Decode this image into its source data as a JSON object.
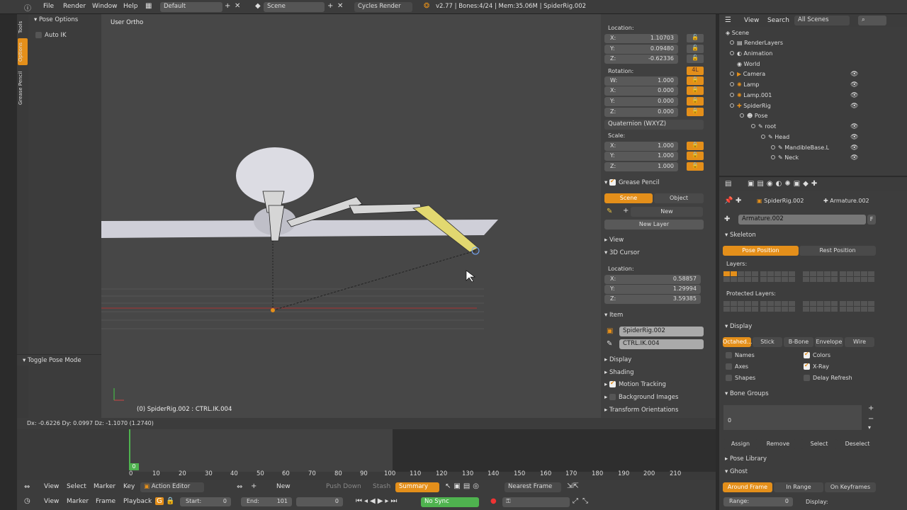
{
  "topbar": {
    "menus": [
      "File",
      "Render",
      "Window",
      "Help"
    ],
    "layout": "Default",
    "scene": "Scene",
    "engine": "Cycles Render",
    "info": "v2.77 | Bones:4/24 | Mem:35.06M | SpiderRig.002"
  },
  "shelf": {
    "tabs": [
      "Tools",
      "Options",
      "Grease Pencil"
    ],
    "pose_options": "Pose Options",
    "auto_ik": "Auto IK",
    "toggle_pose": "Toggle Pose Mode"
  },
  "viewport": {
    "label": "User Ortho",
    "object_info": "(0) SpiderRig.002 : CTRL.IK.004"
  },
  "status": {
    "text": "Dx: -0.6226  Dy: 0.0997  Dz: -1.1070 (1.2740)"
  },
  "npanel": {
    "location_label": "Location:",
    "location": [
      {
        "k": "X:",
        "v": "1.10703"
      },
      {
        "k": "Y:",
        "v": "0.09480"
      },
      {
        "k": "Z:",
        "v": "-0.62336"
      }
    ],
    "rotation_label": "Rotation:",
    "rot_lock": "4L",
    "rotation": [
      {
        "k": "W:",
        "v": "1.000"
      },
      {
        "k": "X:",
        "v": "0.000"
      },
      {
        "k": "Y:",
        "v": "0.000"
      },
      {
        "k": "Z:",
        "v": "0.000"
      }
    ],
    "rot_mode": "Quaternion (WXYZ)",
    "scale_label": "Scale:",
    "scale": [
      {
        "k": "X:",
        "v": "1.000"
      },
      {
        "k": "Y:",
        "v": "1.000"
      },
      {
        "k": "Z:",
        "v": "1.000"
      }
    ],
    "grease_pencil": "Grease Pencil",
    "gp_scene": "Scene",
    "gp_object": "Object",
    "gp_new": "New",
    "gp_new_layer": "New Layer",
    "view": "View",
    "cursor3d": "3D Cursor",
    "cursor_location_label": "Location:",
    "cursor": [
      {
        "k": "X:",
        "v": "0.58857"
      },
      {
        "k": "Y:",
        "v": "1.29994"
      },
      {
        "k": "Z:",
        "v": "3.59385"
      }
    ],
    "item": "Item",
    "item_object": "SpiderRig.002",
    "item_bone": "CTRL.IK.004",
    "display": "Display",
    "shading": "Shading",
    "motion_tracking": "Motion Tracking",
    "background_images": "Background Images",
    "transform_orientations": "Transform Orientations"
  },
  "outliner": {
    "view": "View",
    "search": "Search",
    "filter": "All Scenes",
    "items": [
      "Scene",
      "RenderLayers",
      "Animation",
      "World",
      "Camera",
      "Lamp",
      "Lamp.001",
      "SpiderRig",
      "Pose",
      "root",
      "Head",
      "MandibleBase.L",
      "Neck"
    ]
  },
  "props": {
    "object": "SpiderRig.002",
    "armature": "Armature.002",
    "data_name": "Armature.002",
    "fake": "F",
    "skeleton": "Skeleton",
    "pose_position": "Pose Position",
    "rest_position": "Rest Position",
    "layers": "Layers:",
    "protected_layers": "Protected Layers:",
    "display": "Display",
    "display_modes": [
      "Octahed...",
      "Stick",
      "B-Bone",
      "Envelope",
      "Wire"
    ],
    "names": "Names",
    "axes": "Axes",
    "shapes": "Shapes",
    "colors": "Colors",
    "xray": "X-Ray",
    "delay_refresh": "Delay Refresh",
    "bone_groups": "Bone Groups",
    "bg_index": "0",
    "assign": "Assign",
    "remove": "Remove",
    "select": "Select",
    "deselect": "Deselect",
    "pose_library": "Pose Library",
    "ghost": "Ghost",
    "ghost_modes": [
      "Around Frame",
      "In Range",
      "On Keyframes"
    ],
    "range_label": "Range:",
    "range_value": "0",
    "display_label": "Display:"
  },
  "timeline": {
    "ticks": [
      "0",
      "10",
      "20",
      "30",
      "40",
      "50",
      "60",
      "70",
      "80",
      "90",
      "100",
      "110",
      "120",
      "130",
      "140",
      "150",
      "160",
      "170",
      "180",
      "190",
      "200",
      "210"
    ],
    "current_frame": "0"
  },
  "timeline_header": {
    "menus": [
      "View",
      "Select",
      "Marker",
      "Key"
    ],
    "editor": "Action Editor",
    "push_down": "Push Down",
    "stash": "Stash",
    "new": "New",
    "summary": "Summary",
    "snap": "Nearest Frame"
  },
  "bottom": {
    "menus": [
      "View",
      "Marker",
      "Frame",
      "Playback"
    ],
    "start_label": "Start:",
    "start": "0",
    "end_label": "End:",
    "end": "101",
    "frame": "0",
    "sync": "No Sync"
  }
}
